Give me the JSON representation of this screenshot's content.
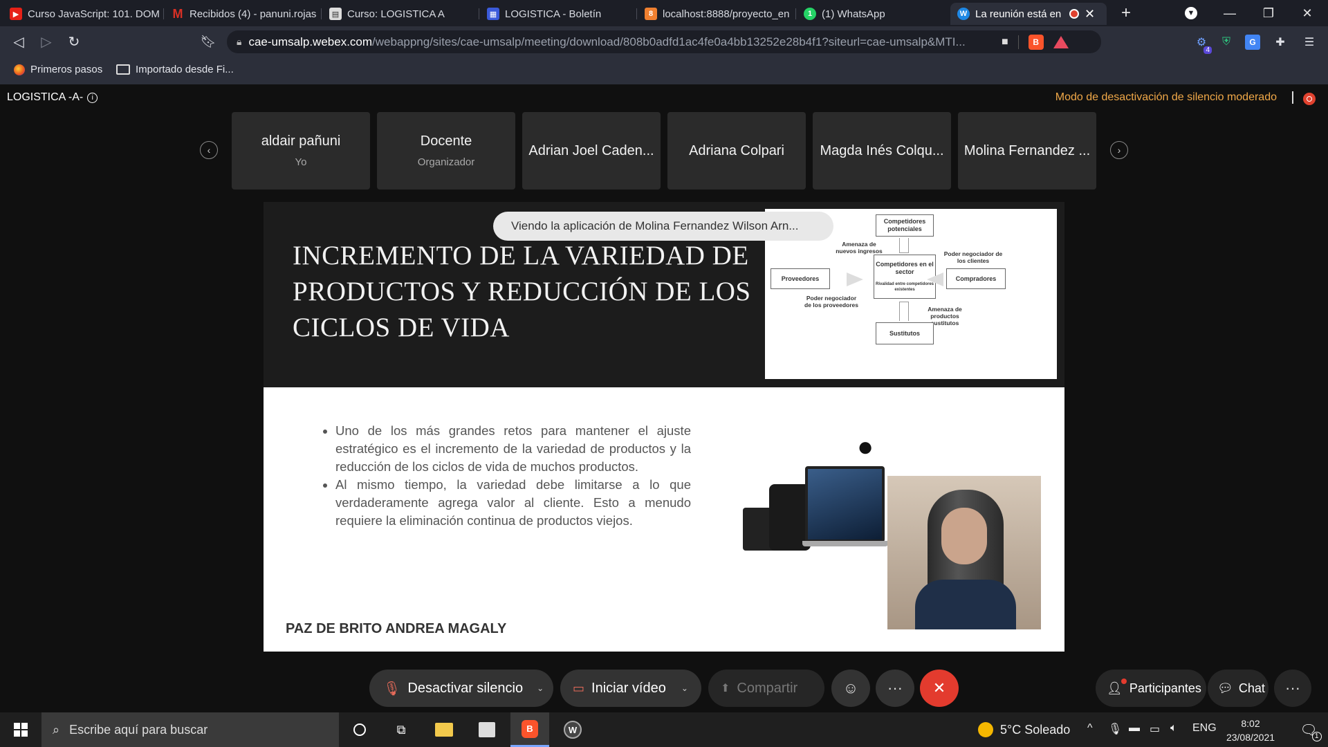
{
  "browser": {
    "tabs": [
      {
        "title": "Curso JavaScript: 101. DOM",
        "icon": "youtube-icon",
        "color": "#e62117"
      },
      {
        "title": "Recibidos (4) - panuni.rojas",
        "icon": "gmail-icon",
        "color": "#d93025"
      },
      {
        "title": "Curso: LOGISTICA A",
        "icon": "moodle-icon",
        "color": "#cccccc"
      },
      {
        "title": "LOGISTICA - Boletín",
        "icon": "boletin-icon",
        "color": "#3b5bdb"
      },
      {
        "title": "localhost:8888/proyecto_en",
        "icon": "localhost-icon",
        "color": "#f08030"
      },
      {
        "title": "(1) WhatsApp",
        "icon": "whatsapp-icon",
        "color": "#25d366"
      },
      {
        "title": "La reunión está en",
        "icon": "webex-icon",
        "color": "#1e88e5"
      }
    ],
    "url_host": "cae-umsalp.webex.com",
    "url_path": "/webappng/sites/cae-umsalp/meeting/download/808b0adfd1ac4fe0a4bb13252e28b4f1?siteurl=cae-umsalp&MTI...",
    "bookmarks": [
      "Primeros pasos",
      "Importado desde Fi..."
    ],
    "extension_badge": "4"
  },
  "meeting": {
    "title": "LOGISTICA -A-",
    "moderated_notice": "Modo de desactivación de silencio moderado",
    "participants": [
      {
        "name": "aldair pañuni",
        "role": "Yo"
      },
      {
        "name": "Docente",
        "role": "Organizador"
      },
      {
        "name": "Adrian Joel Caden...",
        "role": ""
      },
      {
        "name": "Adriana Colpari",
        "role": ""
      },
      {
        "name": "Magda Inés Colqu...",
        "role": ""
      },
      {
        "name": "Molina Fernandez ...",
        "role": ""
      }
    ],
    "viewing_notice": "Viendo la aplicación de Molina Fernandez Wilson Arn..."
  },
  "slide": {
    "title": "INCREMENTO DE LA VARIEDAD DE PRODUCTOS Y REDUCCIÓN DE LOS CICLOS DE VIDA",
    "bullets": [
      "Uno de los más grandes retos para mantener el ajuste estratégico es el incremento de la variedad de productos y la reducción de los ciclos de vida de muchos productos.",
      "Al mismo tiempo, la variedad debe limitarse a lo que verdaderamente agrega valor al cliente. Esto a menudo requiere la eliminación continua de productos viejos."
    ],
    "presenter": "PAZ DE BRITO ANDREA MAGALY",
    "porter": {
      "entrants_box": "Competidores potenciales",
      "entrants_threat": "Amenaza de nuevos ingresos",
      "center_box": "Competidores en el sector",
      "center_sub": "Rivalidad entre competidores existentes",
      "suppliers_box": "Proveedores",
      "suppliers_power": "Poder negociador de los proveedores",
      "buyers_box": "Compradores",
      "buyers_power": "Poder negociador de los clientes",
      "substitutes_box": "Sustitutos",
      "substitutes_threat": "Amenaza de productos sustitutos"
    }
  },
  "controls": {
    "mute": "Desactivar silencio",
    "video": "Iniciar vídeo",
    "share": "Compartir",
    "participants": "Participantes",
    "chat": "Chat",
    "more": "···"
  },
  "taskbar": {
    "search_placeholder": "Escribe aquí para buscar",
    "weather": "5°C  Soleado",
    "lang": "ENG",
    "time": "8:02",
    "date": "23/08/2021",
    "notifications": "1"
  }
}
